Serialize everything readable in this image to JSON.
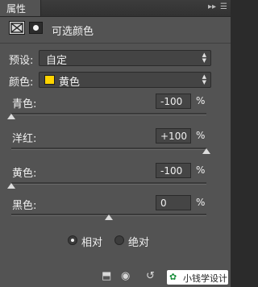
{
  "panel": {
    "tab_title": "属性",
    "collapse_icon": "double-chevron-right",
    "menu_icon": "menu-lines"
  },
  "header": {
    "title": "可选颜色",
    "adjustment_icon": "selective-color-icon",
    "mask_icon": "layer-mask-icon"
  },
  "preset": {
    "label": "预设:",
    "value": "自定"
  },
  "colors": {
    "label": "颜色:",
    "value": "黄色",
    "swatch_color": "#ffd400"
  },
  "sliders": [
    {
      "label": "青色:",
      "value": "-100",
      "unit": "%",
      "position_fraction": 0.0
    },
    {
      "label": "洋红:",
      "value": "+100",
      "unit": "%",
      "position_fraction": 1.0
    },
    {
      "label": "黄色:",
      "value": "-100",
      "unit": "%",
      "position_fraction": 0.0
    },
    {
      "label": "黑色:",
      "value": "0",
      "unit": "%",
      "position_fraction": 0.5
    }
  ],
  "method": {
    "options": [
      "相对",
      "绝对"
    ],
    "selected": "相对"
  },
  "footer": {
    "icons": [
      "clip-to-layer-icon",
      "view-previous-icon",
      "reset-icon",
      "visibility-icon",
      "delete-icon"
    ],
    "watermark_text": "小钱学设计"
  }
}
